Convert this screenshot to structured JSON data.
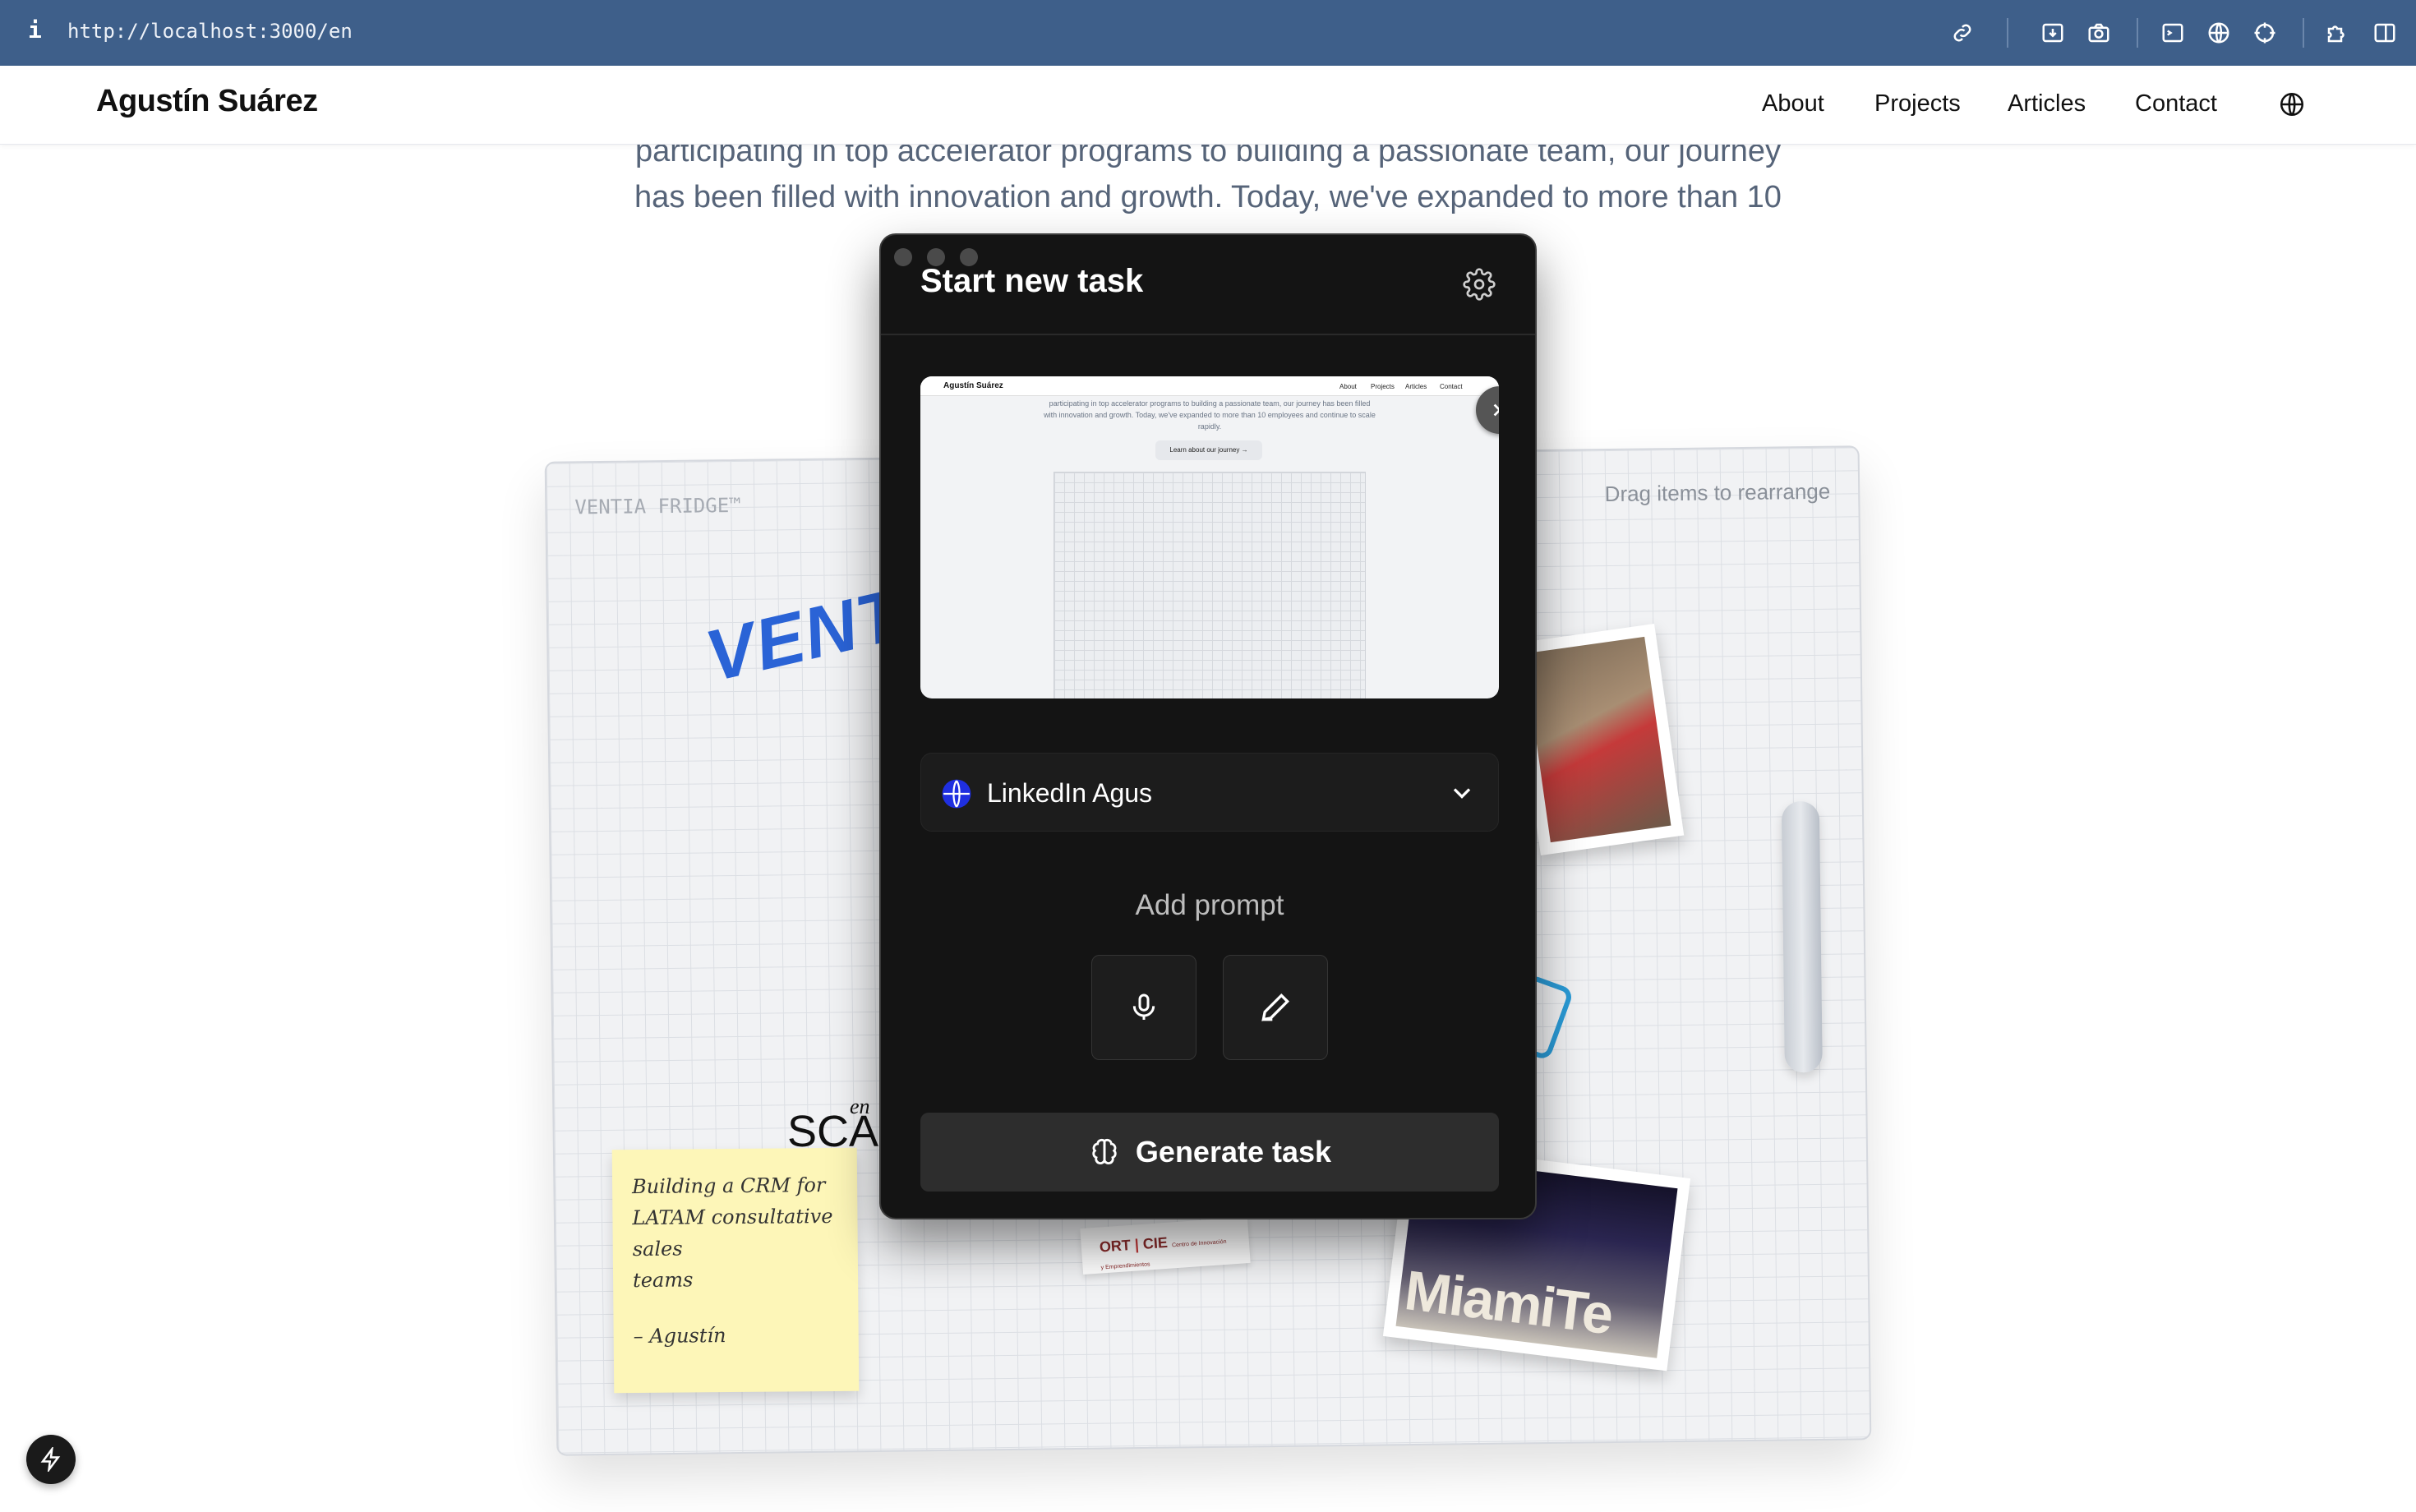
{
  "browser": {
    "info_glyph": "i",
    "url": "http://localhost:3000/en",
    "icons": [
      "link-icon",
      "download-icon",
      "camera-icon",
      "terminal-icon",
      "globe-icon",
      "crosshair-icon",
      "puzzle-icon",
      "sidebar-icon"
    ]
  },
  "header": {
    "brand": "Agustín Suárez",
    "nav": [
      "About",
      "Projects",
      "Articles",
      "Contact"
    ],
    "language_icon": "globe-icon"
  },
  "hero": {
    "line1": "participating in top accelerator programs to building a passionate team, our journey",
    "line2": "has been filled with innovation and growth. Today, we've expanded to more than 10"
  },
  "fridge": {
    "label": "VENTIA FRIDGE™",
    "drag_hint": "Drag items to rearrange",
    "ventia_logo": "VENT",
    "scale_text": "SCAL",
    "scale_prefix": "en",
    "note_lines": [
      "Building a CRM for",
      "LATAM consultative sales",
      "teams"
    ],
    "note_signature": "– Agustín",
    "photo_text": "MiamiTe",
    "ort_label": "ORT",
    "ort_cie": "CIE",
    "ort_sub": "Centro de Innovación y Emprendimientos"
  },
  "panel": {
    "title": "Start new task",
    "settings_icon": "gear-icon",
    "preview": {
      "brand": "Agustín Suárez",
      "nav": [
        "About",
        "Projects",
        "Articles",
        "Contact"
      ],
      "text": "participating in top accelerator programs to building a passionate team, our journey has been filled with innovation and growth. Today, we've expanded to more than 10 employees and continue to scale rapidly.",
      "button": "Learn about our journey →"
    },
    "select": {
      "value": "LinkedIn Agus"
    },
    "add_prompt": "Add prompt",
    "generate_label": "Generate task"
  },
  "colors": {
    "topbar": "#3e5f8a",
    "panel_bg": "#141414",
    "accent_blue": "#2a63d6",
    "note": "#fdf6b8"
  }
}
